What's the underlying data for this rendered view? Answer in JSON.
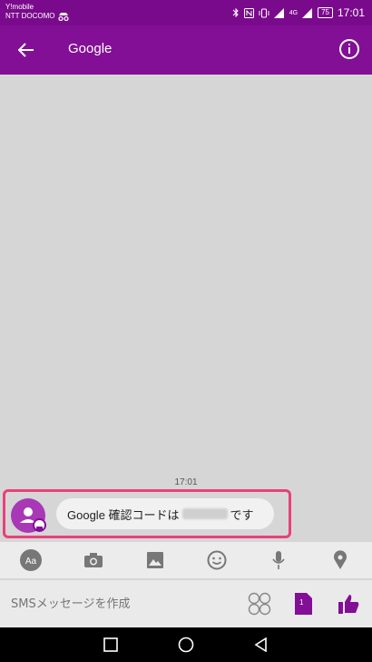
{
  "status_bar": {
    "carrier_primary": "Y!mobile",
    "carrier_secondary": "NTT DOCOMO",
    "battery": "75",
    "time": "17:01",
    "network_label": "4G"
  },
  "app_bar": {
    "title": "Google",
    "back_icon": "arrow-left-icon",
    "info_icon": "info-icon"
  },
  "conversation": {
    "timestamp": "17:01",
    "message": {
      "prefix": "Google 確認コードは",
      "suffix": "です",
      "code_hidden": true
    }
  },
  "toolbar": {
    "icons": [
      "text-format-icon",
      "camera-icon",
      "image-icon",
      "emoji-icon",
      "mic-icon",
      "location-icon"
    ]
  },
  "compose": {
    "placeholder": "SMSメッセージを作成",
    "sim_label": "1"
  },
  "colors": {
    "primary": "#820f95",
    "status": "#7a0a8c",
    "highlight": "#e8407c",
    "avatar": "#a838b6"
  }
}
